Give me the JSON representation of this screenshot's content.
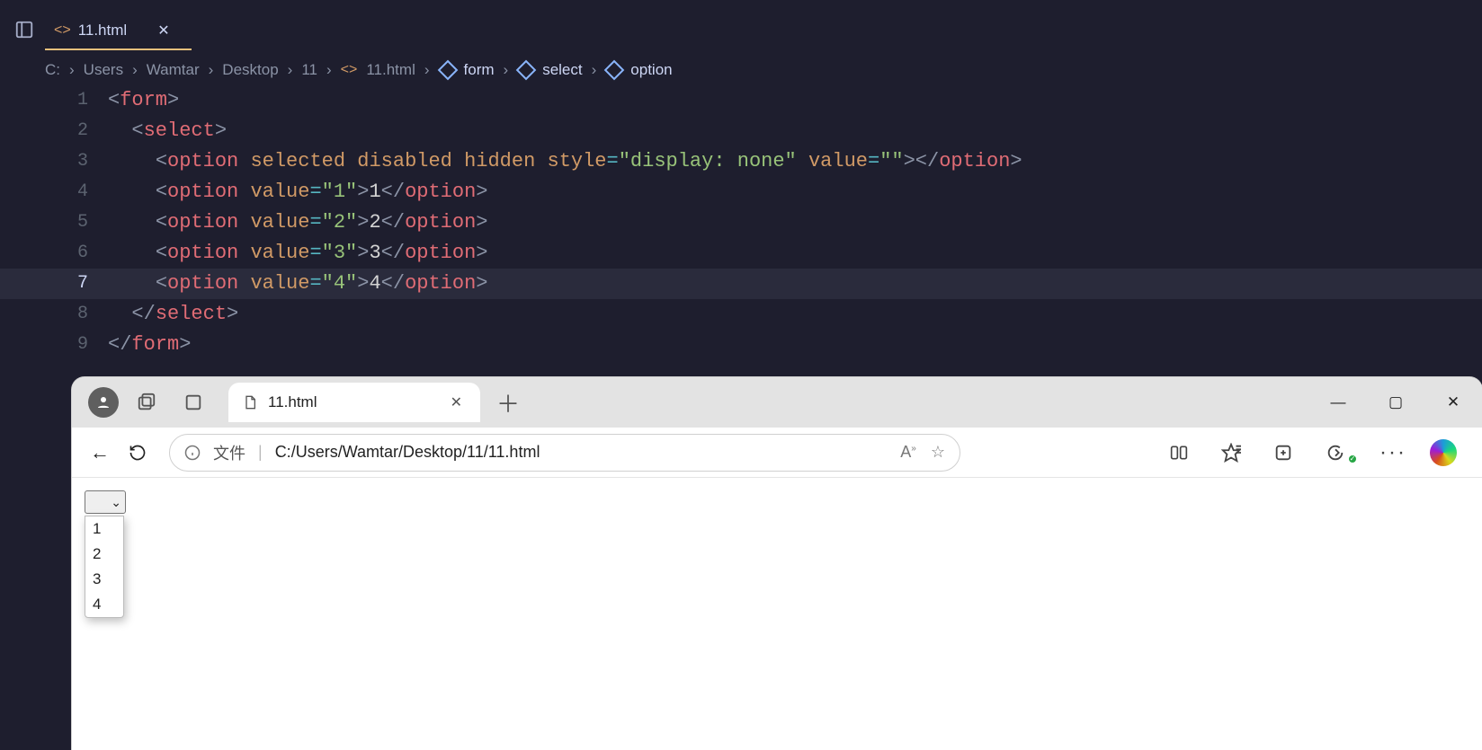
{
  "editor": {
    "tab": {
      "file_icon": "<>",
      "label": "11.html",
      "close": "✕"
    },
    "breadcrumb": {
      "drive": "C:",
      "users": "Users",
      "user": "Wamtar",
      "desktop": "Desktop",
      "folder": "11",
      "file": "11.html",
      "node_form": "form",
      "node_select": "select",
      "node_option": "option"
    },
    "code": {
      "l1": "<form>",
      "l2": "  <select>",
      "l3": {
        "pre": "    <option ",
        "attrs": "selected disabled hidden",
        "style_attr": " style",
        "eq": "=",
        "style_val": "\"display: none\"",
        "val_attr": " value",
        "val_val": "\"\"",
        "tail": "></option>"
      },
      "l4": {
        "pre": "    <option ",
        "val_attr": "value",
        "eq": "=",
        "val_val": "\"1\"",
        "mid": ">",
        "txt": "1",
        "tail": "</option>"
      },
      "l5": {
        "pre": "    <option ",
        "val_attr": "value",
        "eq": "=",
        "val_val": "\"2\"",
        "mid": ">",
        "txt": "2",
        "tail": "</option>"
      },
      "l6": {
        "pre": "    <option ",
        "val_attr": "value",
        "eq": "=",
        "val_val": "\"3\"",
        "mid": ">",
        "txt": "3",
        "tail": "</option>"
      },
      "l7": {
        "pre": "    <option ",
        "val_attr": "value",
        "eq": "=",
        "val_val": "\"4\"",
        "mid": ">",
        "txt": "4",
        "tail": "</option>"
      },
      "l8": "  </select>",
      "l9": "</form>"
    },
    "line_numbers": [
      "1",
      "2",
      "3",
      "4",
      "5",
      "6",
      "7",
      "8",
      "9"
    ]
  },
  "browser": {
    "tab": {
      "label": "11.html",
      "close": "✕"
    },
    "new_tab": "＋",
    "window_controls": {
      "min": "—",
      "max": "▢",
      "close": "✕"
    },
    "address": {
      "proto_label": "文件",
      "sep": "|",
      "url": "C:/Users/Wamtar/Desktop/11/11.html"
    },
    "select_options": [
      "1",
      "2",
      "3",
      "4"
    ]
  }
}
